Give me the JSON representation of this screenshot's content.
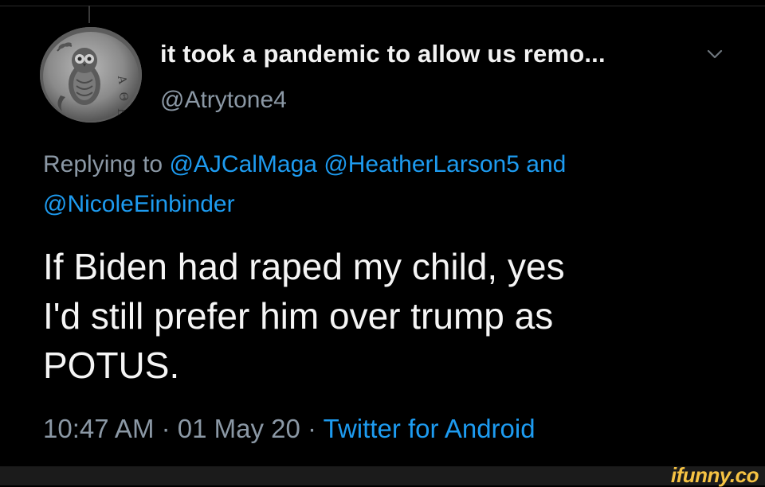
{
  "tweet": {
    "display_name": "it took a pandemic to allow us remo...",
    "handle": "@Atrytone4",
    "replying_to": {
      "prefix": "Replying to",
      "mentions": [
        "@AJCalMaga",
        "@HeatherLarson5",
        "@NicoleEinbinder"
      ],
      "conjunction": "and"
    },
    "text_lines": [
      "If Biden had raped my child, yes",
      "I'd still prefer him over trump as",
      "POTUS."
    ],
    "time": "10:47 AM",
    "separator": "·",
    "date": "01 May 20",
    "source": "Twitter for Android"
  },
  "avatar": {
    "icon": "owl-coin-icon"
  },
  "menu": {
    "icon": "chevron-down-icon"
  },
  "watermark": {
    "text": "ifunny.co"
  },
  "colors": {
    "background": "#000000",
    "text": "#f5f5f5",
    "secondary_text": "#8b98a5",
    "link": "#1d9bf0",
    "watermark": "#f6c343"
  }
}
